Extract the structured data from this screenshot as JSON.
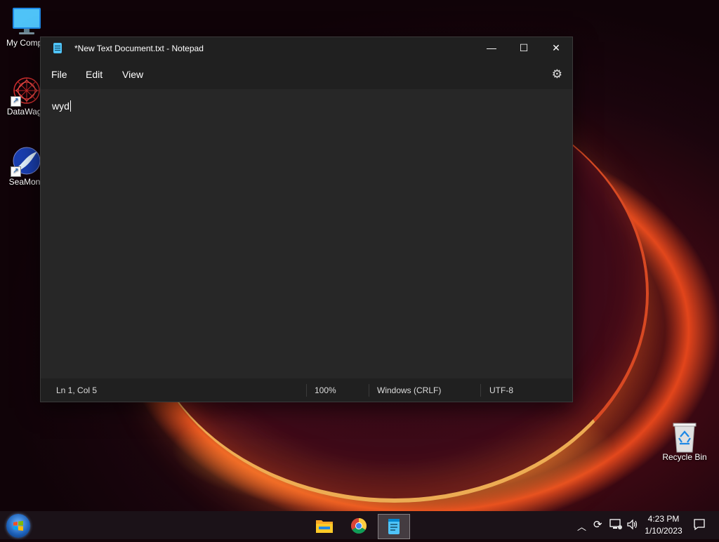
{
  "desktop": {
    "icons": [
      {
        "label": "My Compu"
      },
      {
        "label": "DataWago"
      },
      {
        "label": "SeaMonk"
      },
      {
        "label": "Recycle Bin"
      }
    ]
  },
  "window": {
    "title": "*New Text Document.txt - Notepad",
    "menu": {
      "file": "File",
      "edit": "Edit",
      "view": "View"
    },
    "content": "wyd",
    "status": {
      "position": "Ln 1, Col 5",
      "zoom": "100%",
      "line_ending": "Windows (CRLF)",
      "encoding": "UTF-8"
    },
    "controls": {
      "minimize": "—",
      "maximize": "☐",
      "close": "✕"
    }
  },
  "taskbar": {
    "clock_time": "4:23 PM",
    "clock_date": "1/10/2023",
    "apps": [
      "file-explorer",
      "chrome",
      "notepad"
    ],
    "active_app": "notepad"
  }
}
